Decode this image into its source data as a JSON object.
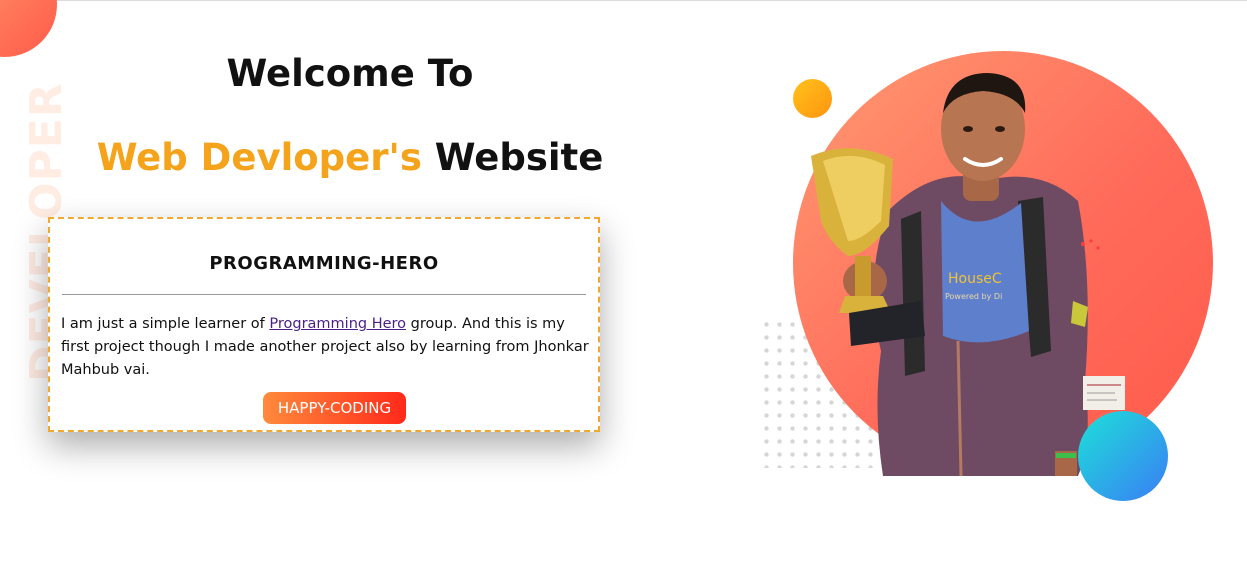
{
  "watermark": "DEVELOPER",
  "heading": {
    "welcome": "Welcome To",
    "title_accent": "Web Devloper's",
    "title_rest": " Website"
  },
  "card": {
    "title": "PROGRAMMING-HERO",
    "text_before": "I am just a simple learner of ",
    "link_text": "Programming Hero",
    "text_after": " group. And this is my first project though I made another project also by learning from Jhonkar Mahbub vai.",
    "button_label": "HAPPY-CODING"
  },
  "colors": {
    "accent": "#f5a31a",
    "button_start": "#ff8a3c",
    "button_end": "#ff2a1a",
    "circle": "#ff6b5a",
    "blue_ball": "#3a7df5"
  }
}
